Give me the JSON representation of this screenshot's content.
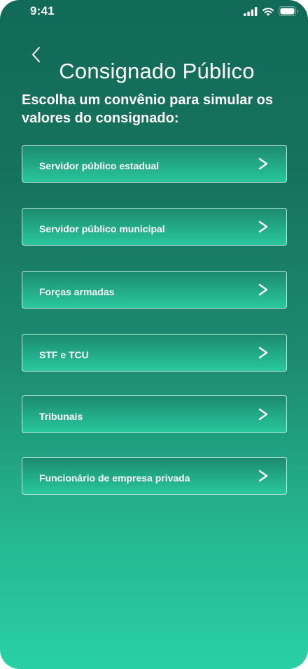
{
  "status_bar": {
    "time": "9:41",
    "icons": [
      "signal-icon",
      "wifi-icon",
      "battery-icon"
    ]
  },
  "header": {
    "back_icon": "chevron-left-icon",
    "title": "Consignado Público"
  },
  "subtitle": "Escolha um convênio para simular os valores do consignado:",
  "options": [
    {
      "label": "Servidor público estadual"
    },
    {
      "label": "Servidor público municipal"
    },
    {
      "label": "Forças armadas"
    },
    {
      "label": "STF e TCU"
    },
    {
      "label": "Tribunais"
    },
    {
      "label": "Funcionário de empresa privada"
    }
  ],
  "colors": {
    "gradient_top": "#126a58",
    "gradient_bottom": "#29d0a6",
    "text": "#ffffff"
  }
}
